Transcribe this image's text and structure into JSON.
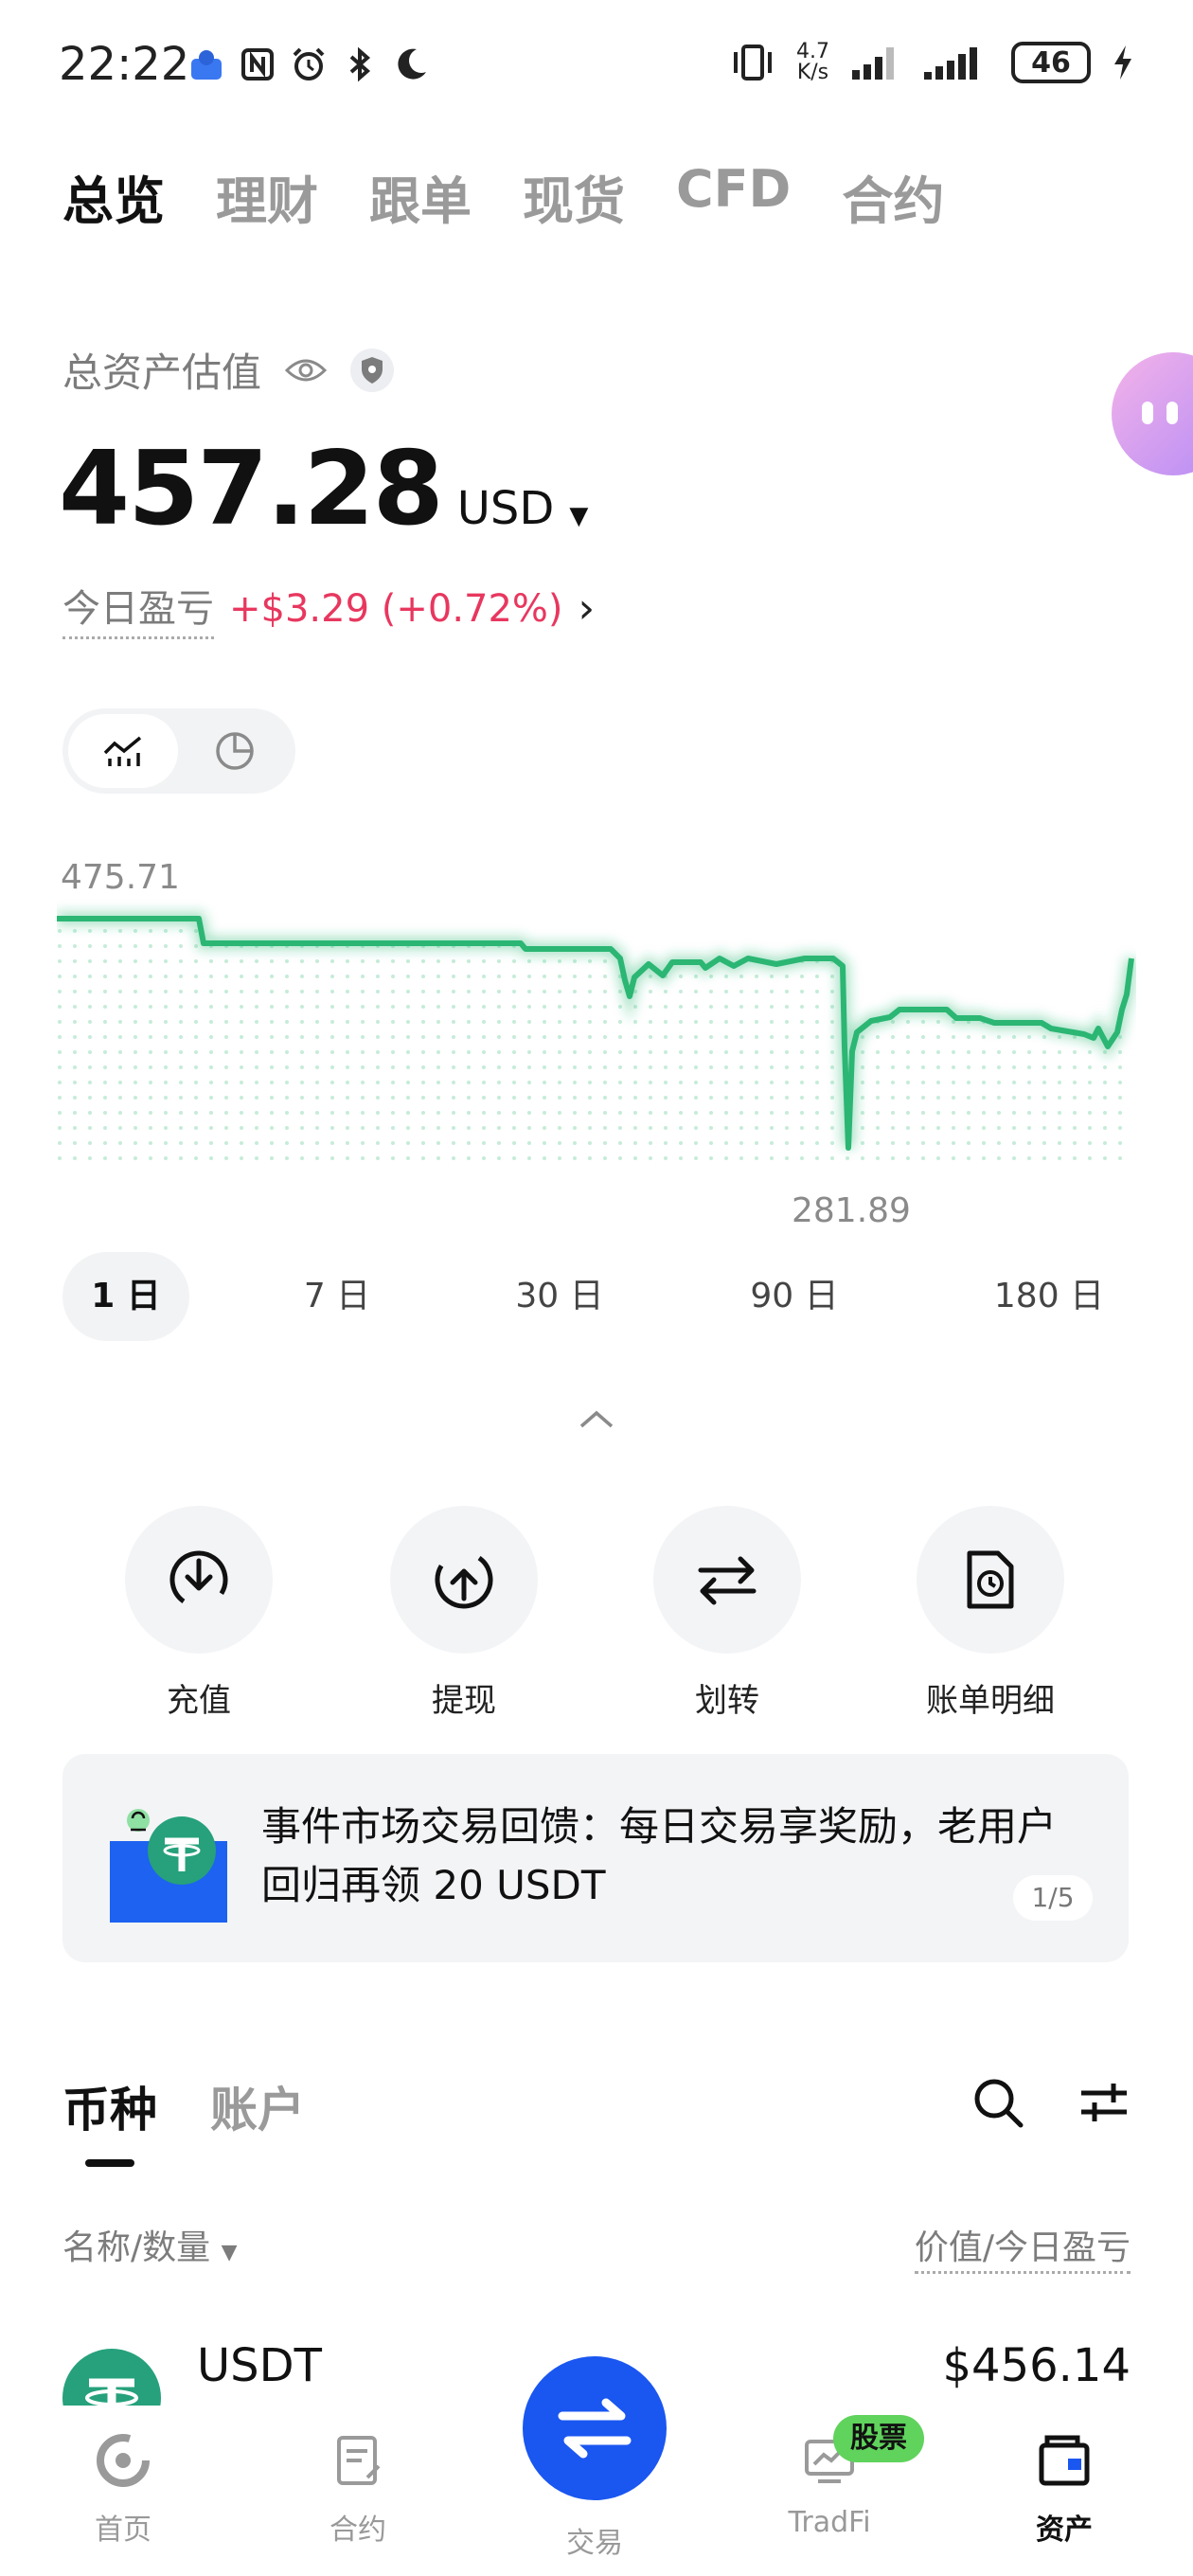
{
  "status_bar": {
    "time": "22:22",
    "net_speed_value": "4.7",
    "net_speed_unit": "K/s",
    "battery": "46"
  },
  "top_tabs": [
    {
      "label": "总览",
      "active": true
    },
    {
      "label": "理财"
    },
    {
      "label": "跟单"
    },
    {
      "label": "现货"
    },
    {
      "label": "CFD"
    },
    {
      "label": "合约"
    }
  ],
  "summary": {
    "label": "总资产估值",
    "amount": "457.28",
    "currency": "USD",
    "pnl_label": "今日盈亏",
    "pnl_value": "+$3.29 (+0.72%)"
  },
  "chart": {
    "max_label": "475.71",
    "min_label": "281.89",
    "line_color": "#2bb673"
  },
  "periods": [
    {
      "label": "1 日",
      "active": true
    },
    {
      "label": "7 日"
    },
    {
      "label": "30 日"
    },
    {
      "label": "90 日"
    },
    {
      "label": "180 日"
    }
  ],
  "actions": [
    {
      "label": "充值",
      "icon": "deposit-icon"
    },
    {
      "label": "提现",
      "icon": "withdraw-icon"
    },
    {
      "label": "划转",
      "icon": "transfer-icon"
    },
    {
      "label": "账单明细",
      "icon": "bill-icon"
    }
  ],
  "banner": {
    "text": "事件市场交易回馈：每日交易享奖励，老用户回归再领 20 USDT",
    "pager": "1/5"
  },
  "list_tabs": [
    {
      "label": "币种",
      "active": true
    },
    {
      "label": "账户"
    }
  ],
  "column_headers": {
    "left": "名称/数量",
    "right": "价值/今日盈亏"
  },
  "assets": [
    {
      "name": "USDT",
      "value": "$456.14"
    }
  ],
  "bottom_nav": {
    "home": "首页",
    "futures": "合约",
    "trade": "交易",
    "tradfi": "TradFi",
    "tradfi_badge": "股票",
    "assets": "资产"
  }
}
